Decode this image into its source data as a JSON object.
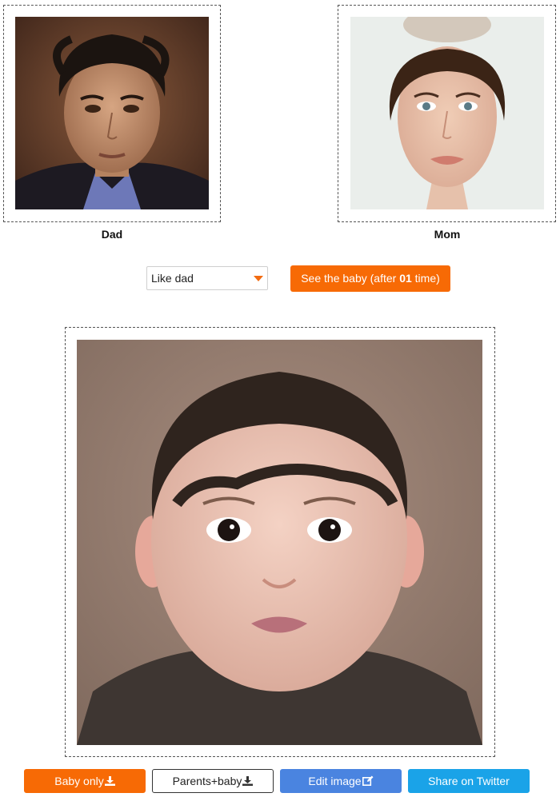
{
  "parents": {
    "dad_label": "Dad",
    "mom_label": "Mom"
  },
  "controls": {
    "likeness_selected": "Like dad",
    "see_baby_prefix": "See the baby (after ",
    "see_baby_count": "01",
    "see_baby_suffix": " time)"
  },
  "actions": {
    "baby_only": "Baby only",
    "parents_baby": "Parents+baby",
    "edit_image": "Edit image",
    "share_twitter": "Share on Twitter"
  },
  "icons": {
    "download": "download-icon",
    "edit": "edit-icon",
    "dropdown": "caret-down-icon"
  },
  "colors": {
    "accent_orange": "#f76a05",
    "edit_blue": "#4a84e0",
    "twitter_cyan": "#1aa3e8"
  }
}
